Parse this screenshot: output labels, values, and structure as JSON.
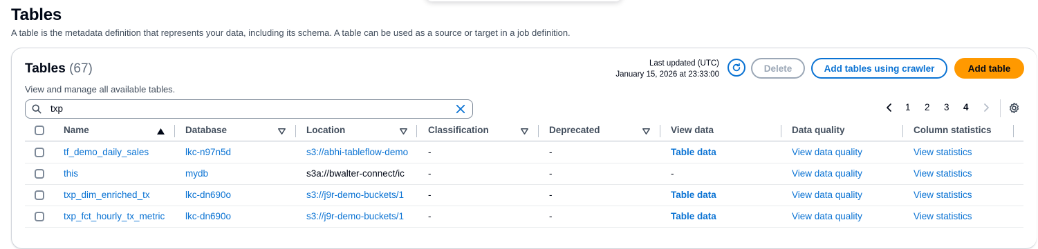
{
  "page": {
    "title": "Tables",
    "description": "A table is the metadata definition that represents your data, including its schema. A table can be used as a source or target in a job definition."
  },
  "container": {
    "title": "Tables",
    "count": "(67)",
    "description": "View and manage all available tables.",
    "last_updated_label": "Last updated (UTC)",
    "last_updated_value": "January 15, 2026 at 23:33:00",
    "buttons": {
      "delete": "Delete",
      "add_crawler": "Add tables using crawler",
      "add_table": "Add table"
    }
  },
  "search": {
    "value": "txp"
  },
  "pagination": {
    "pages": [
      "1",
      "2",
      "3",
      "4"
    ],
    "current": "4"
  },
  "columns": [
    "Name",
    "Database",
    "Location",
    "Classification",
    "Deprecated",
    "View data",
    "Data quality",
    "Column statistics"
  ],
  "rows": [
    {
      "name": "tf_demo_daily_sales",
      "database": "lkc-n97n5d",
      "location": "s3://abhi-tableflow-demo",
      "classification": "-",
      "deprecated": "-",
      "view_data": "Table data",
      "data_quality": "View data quality",
      "column_statistics": "View statistics"
    },
    {
      "name": "this",
      "database": "mydb",
      "location": "s3a://bwalter-connect/ic",
      "classification": "-",
      "deprecated": "-",
      "view_data": "-",
      "data_quality": "View data quality",
      "column_statistics": "View statistics"
    },
    {
      "name": "txp_dim_enriched_tx",
      "database": "lkc-dn690o",
      "location": "s3://j9r-demo-buckets/1",
      "classification": "-",
      "deprecated": "-",
      "view_data": "Table data",
      "data_quality": "View data quality",
      "column_statistics": "View statistics"
    },
    {
      "name": "txp_fct_hourly_tx_metric",
      "database": "lkc-dn690o",
      "location": "s3://j9r-demo-buckets/1",
      "classification": "-",
      "deprecated": "-",
      "view_data": "Table data",
      "data_quality": "View data quality",
      "column_statistics": "View statistics"
    }
  ],
  "colors": {
    "link": "#0972d3",
    "primary_button": "#ff9900",
    "text": "#000716",
    "border": "#7d8998"
  }
}
